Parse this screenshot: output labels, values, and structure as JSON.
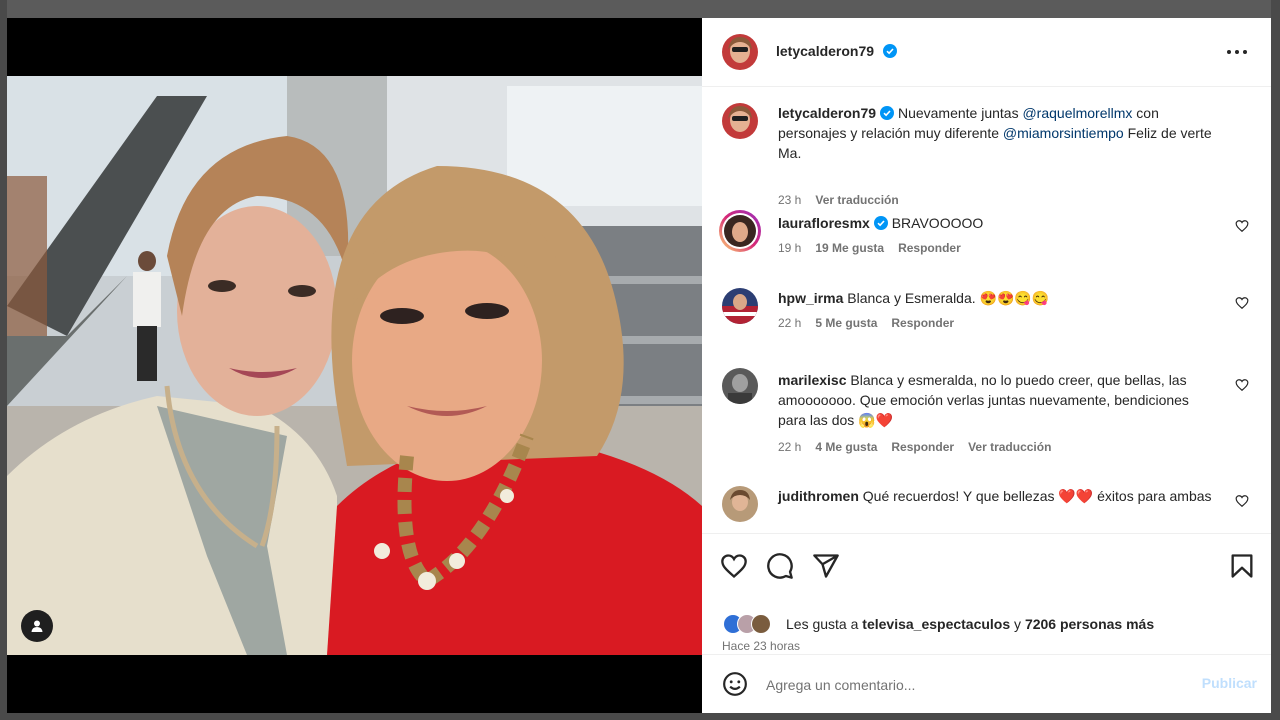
{
  "post": {
    "author": "letycalderon79",
    "more_icon": "more-horizontal-icon"
  },
  "caption": {
    "author": "letycalderon79",
    "text_1": " Nuevamente juntas ",
    "mention_1": "@raquelmorellmx",
    "text_2": " con personajes y relación muy diferente ",
    "mention_2": "@miamorsintiempo",
    "text_3": " Feliz de verte Ma.",
    "time": "23 h",
    "translate": "Ver traducción"
  },
  "comments": [
    {
      "user": "lauraflores mx",
      "user_display": "laurafloresmx",
      "verified": true,
      "text": "BRAVOOOOO",
      "time": "19 h",
      "likes": "19 Me gusta",
      "reply": "Responder"
    },
    {
      "user_display": "hpw_irma",
      "verified": false,
      "text": "Blanca y Esmeralda. 😍😍😋😋",
      "time": "22 h",
      "likes": "5 Me gusta",
      "reply": "Responder"
    },
    {
      "user_display": "marilexisc",
      "verified": false,
      "text": "Blanca y esmeralda, no lo puedo creer, que bellas, las amooooooo. Que emoción verlas juntas nuevamente, bendiciones para las dos 😱❤️",
      "time": "22 h",
      "likes": "4 Me gusta",
      "reply": "Responder",
      "translate": "Ver traducción"
    },
    {
      "user_display": "judithromen",
      "verified": false,
      "text": "Qué recuerdos! Y que bellezas ❤️❤️ éxitos para ambas"
    }
  ],
  "likes": {
    "prefix": "Les gusta a ",
    "user": "televisa_espectaculos",
    "connector": " y ",
    "others": "7206 personas más"
  },
  "time_ago": "Hace 23 horas",
  "add_comment": {
    "placeholder": "Agrega un comentario...",
    "publish": "Publicar"
  },
  "colors": {
    "verified": "#0095f6",
    "mention": "#00376b",
    "publish_disabled": "#c0dffd"
  }
}
